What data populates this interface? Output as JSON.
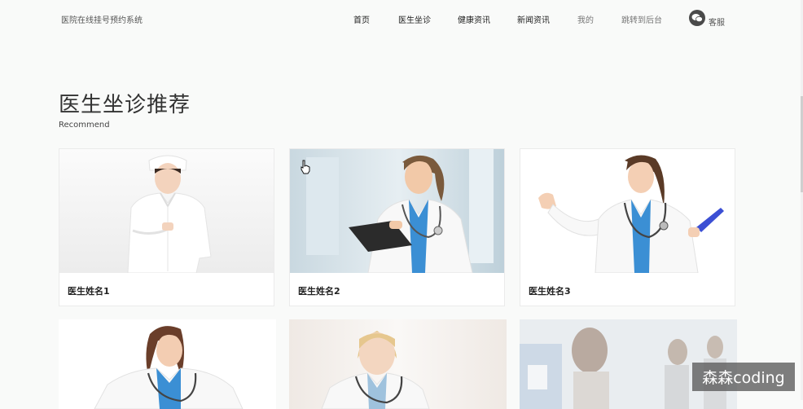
{
  "header": {
    "site_name": "医院在线挂号预约系统",
    "nav": [
      "首页",
      "医生坐诊",
      "健康资讯",
      "新闻资讯",
      "我的",
      "跳转到后台"
    ],
    "customer_service": "客服"
  },
  "section": {
    "title": "医生坐诊推荐",
    "subtitle": "Recommend"
  },
  "doctors": [
    {
      "name": "医生姓名1",
      "icon": "doctor-photo-icon"
    },
    {
      "name": "医生姓名2",
      "icon": "doctor-photo-icon"
    },
    {
      "name": "医生姓名3",
      "icon": "doctor-photo-icon"
    }
  ],
  "watermark": "森森coding",
  "colors": {
    "background": "#f9faf9",
    "card_border": "#ebebeb",
    "coat": "#ffffff",
    "scrub_blue": "#3b8fd4",
    "watermark_bg": "#5a5a5a"
  }
}
